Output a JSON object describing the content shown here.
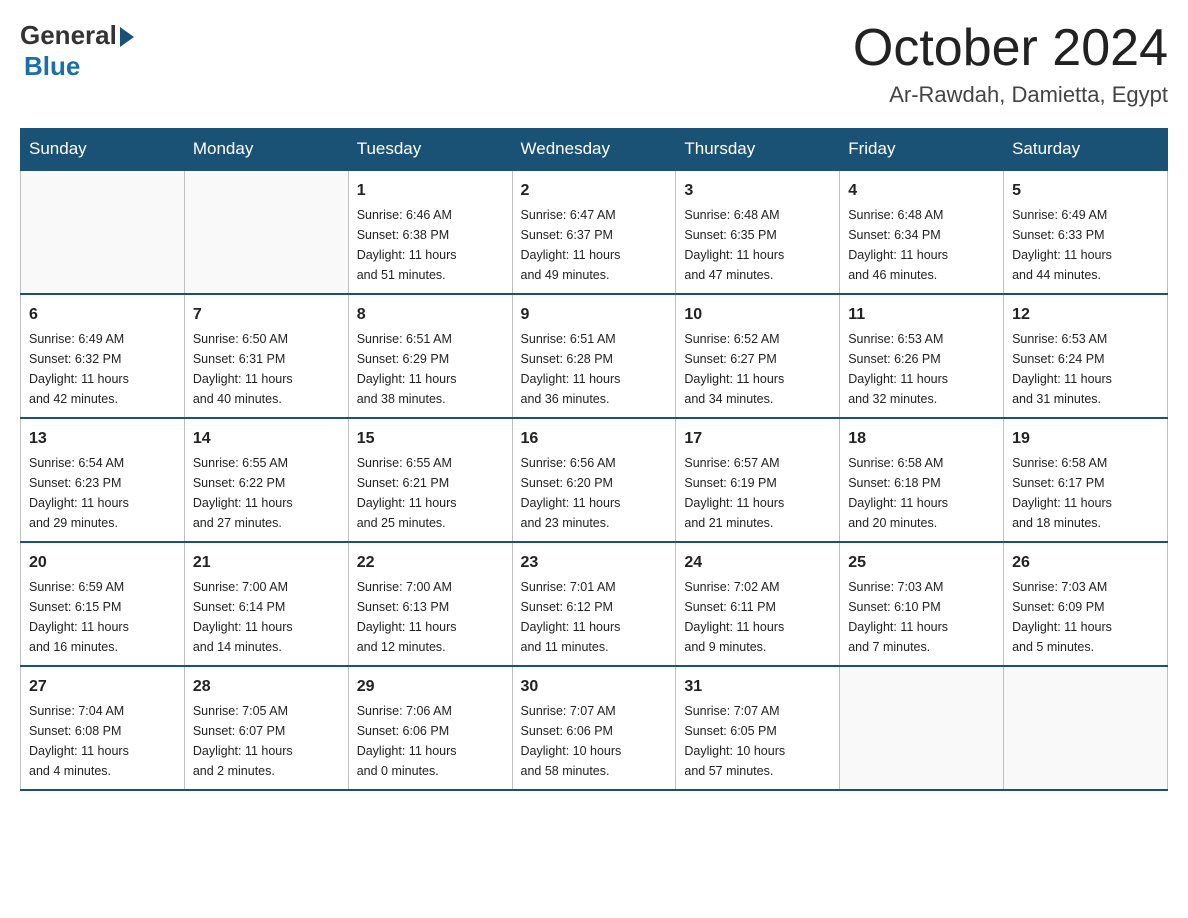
{
  "logo": {
    "general": "General",
    "blue": "Blue"
  },
  "title": "October 2024",
  "location": "Ar-Rawdah, Damietta, Egypt",
  "days_of_week": [
    "Sunday",
    "Monday",
    "Tuesday",
    "Wednesday",
    "Thursday",
    "Friday",
    "Saturday"
  ],
  "weeks": [
    [
      {
        "day": "",
        "info": ""
      },
      {
        "day": "",
        "info": ""
      },
      {
        "day": "1",
        "info": "Sunrise: 6:46 AM\nSunset: 6:38 PM\nDaylight: 11 hours\nand 51 minutes."
      },
      {
        "day": "2",
        "info": "Sunrise: 6:47 AM\nSunset: 6:37 PM\nDaylight: 11 hours\nand 49 minutes."
      },
      {
        "day": "3",
        "info": "Sunrise: 6:48 AM\nSunset: 6:35 PM\nDaylight: 11 hours\nand 47 minutes."
      },
      {
        "day": "4",
        "info": "Sunrise: 6:48 AM\nSunset: 6:34 PM\nDaylight: 11 hours\nand 46 minutes."
      },
      {
        "day": "5",
        "info": "Sunrise: 6:49 AM\nSunset: 6:33 PM\nDaylight: 11 hours\nand 44 minutes."
      }
    ],
    [
      {
        "day": "6",
        "info": "Sunrise: 6:49 AM\nSunset: 6:32 PM\nDaylight: 11 hours\nand 42 minutes."
      },
      {
        "day": "7",
        "info": "Sunrise: 6:50 AM\nSunset: 6:31 PM\nDaylight: 11 hours\nand 40 minutes."
      },
      {
        "day": "8",
        "info": "Sunrise: 6:51 AM\nSunset: 6:29 PM\nDaylight: 11 hours\nand 38 minutes."
      },
      {
        "day": "9",
        "info": "Sunrise: 6:51 AM\nSunset: 6:28 PM\nDaylight: 11 hours\nand 36 minutes."
      },
      {
        "day": "10",
        "info": "Sunrise: 6:52 AM\nSunset: 6:27 PM\nDaylight: 11 hours\nand 34 minutes."
      },
      {
        "day": "11",
        "info": "Sunrise: 6:53 AM\nSunset: 6:26 PM\nDaylight: 11 hours\nand 32 minutes."
      },
      {
        "day": "12",
        "info": "Sunrise: 6:53 AM\nSunset: 6:24 PM\nDaylight: 11 hours\nand 31 minutes."
      }
    ],
    [
      {
        "day": "13",
        "info": "Sunrise: 6:54 AM\nSunset: 6:23 PM\nDaylight: 11 hours\nand 29 minutes."
      },
      {
        "day": "14",
        "info": "Sunrise: 6:55 AM\nSunset: 6:22 PM\nDaylight: 11 hours\nand 27 minutes."
      },
      {
        "day": "15",
        "info": "Sunrise: 6:55 AM\nSunset: 6:21 PM\nDaylight: 11 hours\nand 25 minutes."
      },
      {
        "day": "16",
        "info": "Sunrise: 6:56 AM\nSunset: 6:20 PM\nDaylight: 11 hours\nand 23 minutes."
      },
      {
        "day": "17",
        "info": "Sunrise: 6:57 AM\nSunset: 6:19 PM\nDaylight: 11 hours\nand 21 minutes."
      },
      {
        "day": "18",
        "info": "Sunrise: 6:58 AM\nSunset: 6:18 PM\nDaylight: 11 hours\nand 20 minutes."
      },
      {
        "day": "19",
        "info": "Sunrise: 6:58 AM\nSunset: 6:17 PM\nDaylight: 11 hours\nand 18 minutes."
      }
    ],
    [
      {
        "day": "20",
        "info": "Sunrise: 6:59 AM\nSunset: 6:15 PM\nDaylight: 11 hours\nand 16 minutes."
      },
      {
        "day": "21",
        "info": "Sunrise: 7:00 AM\nSunset: 6:14 PM\nDaylight: 11 hours\nand 14 minutes."
      },
      {
        "day": "22",
        "info": "Sunrise: 7:00 AM\nSunset: 6:13 PM\nDaylight: 11 hours\nand 12 minutes."
      },
      {
        "day": "23",
        "info": "Sunrise: 7:01 AM\nSunset: 6:12 PM\nDaylight: 11 hours\nand 11 minutes."
      },
      {
        "day": "24",
        "info": "Sunrise: 7:02 AM\nSunset: 6:11 PM\nDaylight: 11 hours\nand 9 minutes."
      },
      {
        "day": "25",
        "info": "Sunrise: 7:03 AM\nSunset: 6:10 PM\nDaylight: 11 hours\nand 7 minutes."
      },
      {
        "day": "26",
        "info": "Sunrise: 7:03 AM\nSunset: 6:09 PM\nDaylight: 11 hours\nand 5 minutes."
      }
    ],
    [
      {
        "day": "27",
        "info": "Sunrise: 7:04 AM\nSunset: 6:08 PM\nDaylight: 11 hours\nand 4 minutes."
      },
      {
        "day": "28",
        "info": "Sunrise: 7:05 AM\nSunset: 6:07 PM\nDaylight: 11 hours\nand 2 minutes."
      },
      {
        "day": "29",
        "info": "Sunrise: 7:06 AM\nSunset: 6:06 PM\nDaylight: 11 hours\nand 0 minutes."
      },
      {
        "day": "30",
        "info": "Sunrise: 7:07 AM\nSunset: 6:06 PM\nDaylight: 10 hours\nand 58 minutes."
      },
      {
        "day": "31",
        "info": "Sunrise: 7:07 AM\nSunset: 6:05 PM\nDaylight: 10 hours\nand 57 minutes."
      },
      {
        "day": "",
        "info": ""
      },
      {
        "day": "",
        "info": ""
      }
    ]
  ]
}
